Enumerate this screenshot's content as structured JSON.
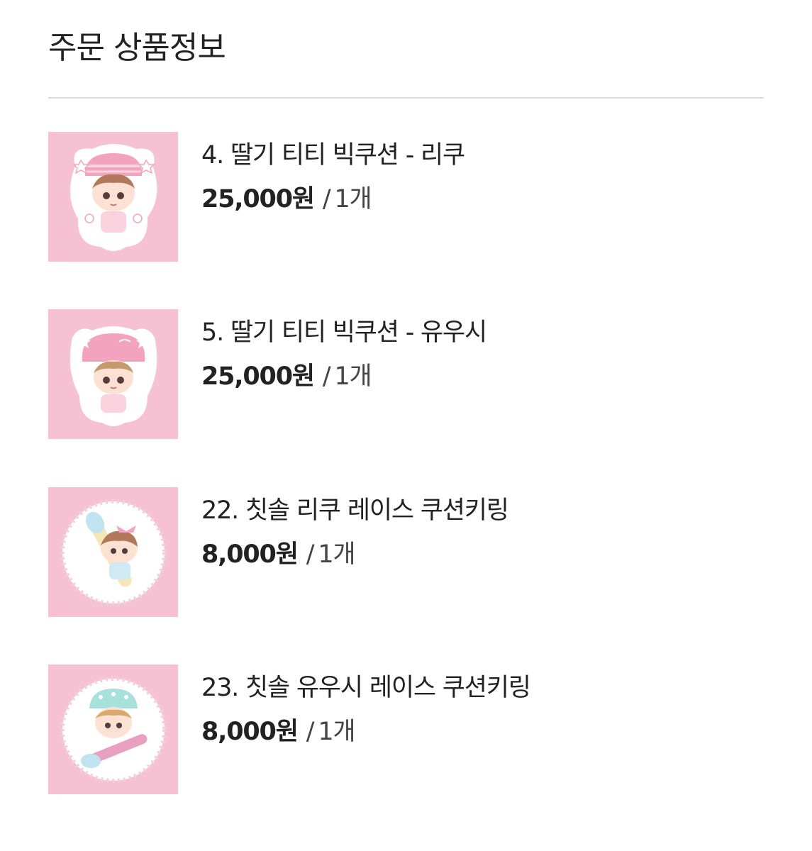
{
  "section": {
    "title": "주문 상품정보"
  },
  "items": [
    {
      "name": "4. 딸기 티티 빅쿠션 - 리쿠",
      "price": "25,000원",
      "separator": "/",
      "quantity": "1개",
      "thumbnail_icon": "pink-bear-hat-cushion"
    },
    {
      "name": "5. 딸기 티티 빅쿠션 - 유우시",
      "price": "25,000원",
      "separator": "/",
      "quantity": "1개",
      "thumbnail_icon": "pink-bear-hat-cushion"
    },
    {
      "name": "22. 칫솔 리쿠 레이스 쿠션키링",
      "price": "8,000원",
      "separator": "/",
      "quantity": "1개",
      "thumbnail_icon": "toothbrush-lace-keyring"
    },
    {
      "name": "23. 칫솔 유우시 레이스 쿠션키링",
      "price": "8,000원",
      "separator": "/",
      "quantity": "1개",
      "thumbnail_icon": "toothbrush-lace-keyring"
    }
  ],
  "colors": {
    "thumbnail_bg": "#f6c1d2",
    "divider": "#dcdcdc",
    "text": "#222222"
  }
}
